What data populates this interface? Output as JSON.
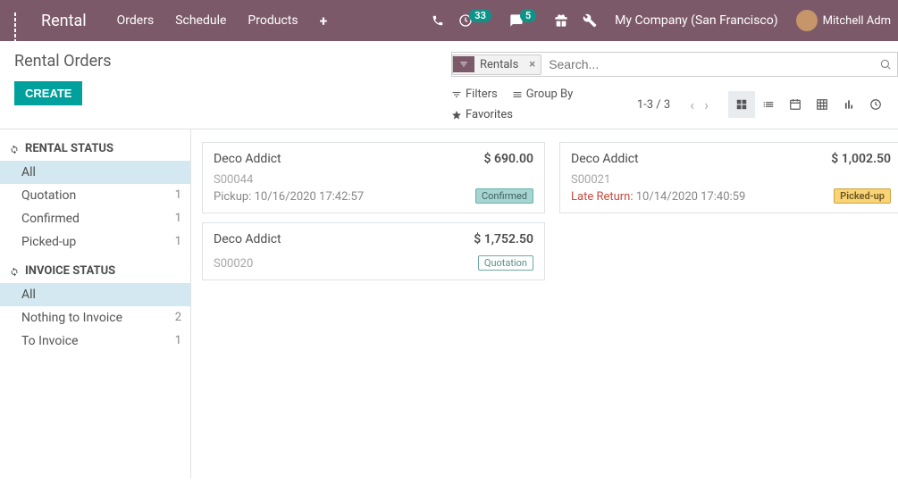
{
  "nav": {
    "brand": "Rental",
    "links": [
      "Orders",
      "Schedule",
      "Products"
    ],
    "badges": {
      "activity": "33",
      "messages": "5"
    },
    "company": "My Company (San Francisco)",
    "user": "Mitchell Adm"
  },
  "header": {
    "title": "Rental Orders",
    "create_label": "CREATE"
  },
  "search": {
    "facet_label": "Rentals",
    "placeholder": "Search...",
    "filters_label": "Filters",
    "groupby_label": "Group By",
    "favorites_label": "Favorites",
    "pager": "1-3 / 3"
  },
  "sidebar": {
    "sections": [
      {
        "title": "RENTAL STATUS",
        "items": [
          {
            "label": "All",
            "count": "",
            "active": true
          },
          {
            "label": "Quotation",
            "count": "1"
          },
          {
            "label": "Confirmed",
            "count": "1"
          },
          {
            "label": "Picked-up",
            "count": "1"
          }
        ]
      },
      {
        "title": "INVOICE STATUS",
        "items": [
          {
            "label": "All",
            "count": "",
            "active": true
          },
          {
            "label": "Nothing to Invoice",
            "count": "2"
          },
          {
            "label": "To Invoice",
            "count": "1"
          }
        ]
      }
    ]
  },
  "cards": {
    "col1": [
      {
        "title": "Deco Addict",
        "price": "$ 690.00",
        "num": "S00044",
        "line_label": "Pickup:",
        "date": "10/16/2020 17:42:57",
        "tag": "Confirmed",
        "tag_cls": "tag-confirmed",
        "late": false
      },
      {
        "title": "Deco Addict",
        "price": "$ 1,752.50",
        "num": "S00020",
        "line_label": "",
        "date": "",
        "tag": "Quotation",
        "tag_cls": "tag-quotation",
        "late": false
      }
    ],
    "col2": [
      {
        "title": "Deco Addict",
        "price": "$ 1,002.50",
        "num": "S00021",
        "line_label": "Late Return:",
        "date": "10/14/2020 17:40:59",
        "tag": "Picked-up",
        "tag_cls": "tag-picked",
        "late": true
      }
    ]
  }
}
